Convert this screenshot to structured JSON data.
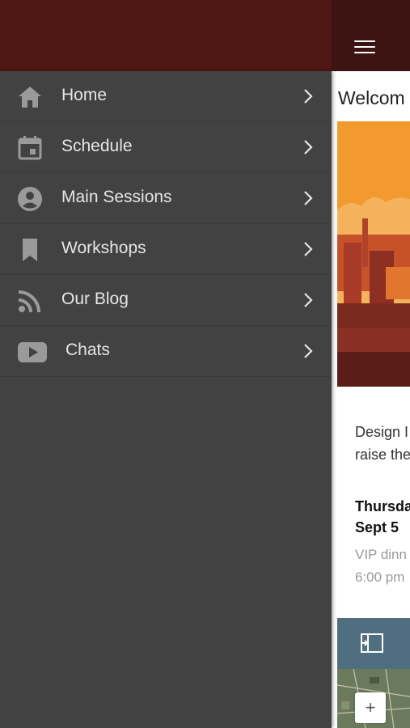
{
  "colors": {
    "drawer_bg": "#424242",
    "header_bg": "#4f1714",
    "label": "#e6e6e6",
    "icon": "#9a9a9a"
  },
  "menu": {
    "items": [
      {
        "label": "Home",
        "icon": "home-icon"
      },
      {
        "label": "Schedule",
        "icon": "calendar-icon"
      },
      {
        "label": "Main Sessions",
        "icon": "person-icon"
      },
      {
        "label": "Workshops",
        "icon": "bookmark-icon"
      },
      {
        "label": "Our Blog",
        "icon": "rss-icon"
      },
      {
        "label": "Chats",
        "icon": "youtube-icon"
      }
    ]
  },
  "main": {
    "welcome": "Welcom",
    "body_line1": "Design I",
    "body_line2": "raise the",
    "event_day": "Thursda",
    "event_date": "Sept 5",
    "event_title": "VIP dinn",
    "event_time": "6:00 pm",
    "zoom_in": "+"
  }
}
